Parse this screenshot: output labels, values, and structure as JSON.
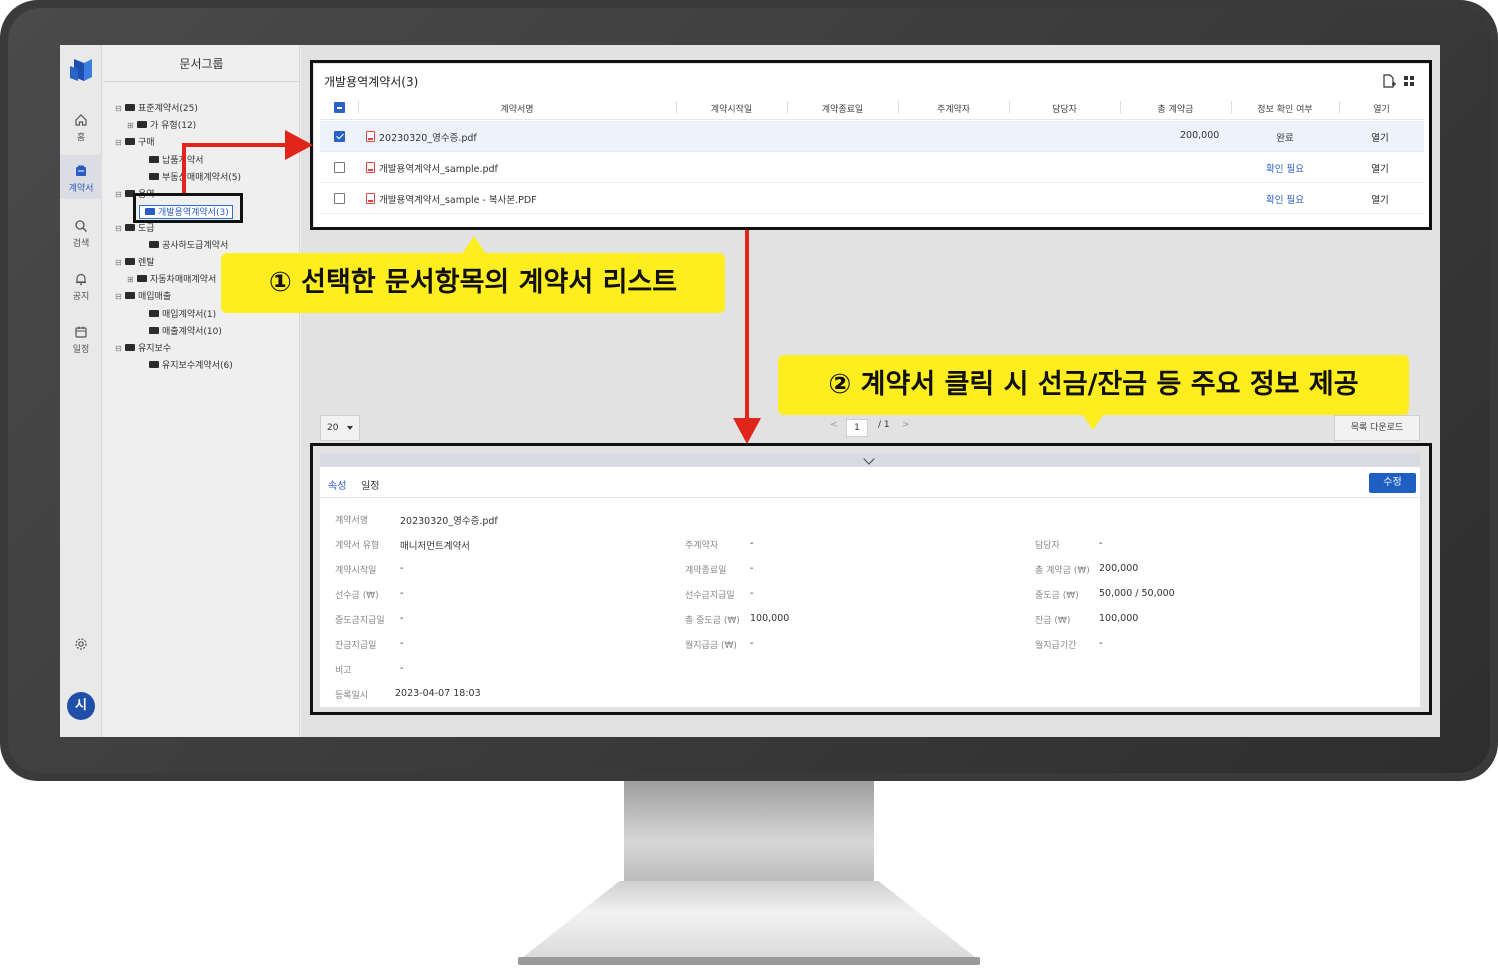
{
  "rail": {
    "items": [
      {
        "label": "홈",
        "icon": "home-icon"
      },
      {
        "label": "계약서",
        "icon": "contract-icon"
      },
      {
        "label": "검색",
        "icon": "search-icon"
      },
      {
        "label": "공지",
        "icon": "bell-icon"
      },
      {
        "label": "일정",
        "icon": "calendar-icon"
      }
    ],
    "avatar": "시",
    "accent": "#2a5cc2"
  },
  "tree": {
    "title": "문서그룹",
    "nodes": [
      {
        "label": "표준계약서(25)",
        "toggle": "⊟"
      },
      {
        "label": "가 유형(12)",
        "toggle": "⊞"
      },
      {
        "label": "구매",
        "toggle": "⊟"
      },
      {
        "label": "납품계약서",
        "toggle": ""
      },
      {
        "label": "부동산매매계약서(5)",
        "toggle": ""
      },
      {
        "label": "용역",
        "toggle": "⊟"
      },
      {
        "label": "개발용역계약서(3)",
        "toggle": ""
      },
      {
        "label": "도급",
        "toggle": "⊟"
      },
      {
        "label": "공사하도급계약서",
        "toggle": ""
      },
      {
        "label": "렌탈",
        "toggle": "⊟"
      },
      {
        "label": "자동차매매계약서",
        "toggle": "⊞"
      },
      {
        "label": "매입매출",
        "toggle": "⊟"
      },
      {
        "label": "매입계약서(1)",
        "toggle": ""
      },
      {
        "label": "매출계약서(10)",
        "toggle": ""
      },
      {
        "label": "유지보수",
        "toggle": "⊟"
      },
      {
        "label": "유지보수계약서(6)",
        "toggle": ""
      }
    ]
  },
  "list": {
    "title": "개발용역계약서(3)",
    "columns": [
      "계약서명",
      "계약시작일",
      "계약종료일",
      "주계약자",
      "담당자",
      "총 계약금",
      "정보 확인 여부",
      "열기"
    ],
    "rows": [
      {
        "name": "20230320_영수증.pdf",
        "amount": "200,000",
        "status": "완료",
        "open": "열기",
        "selected": true
      },
      {
        "name": "개발용역계약서_sample.pdf",
        "amount": "",
        "status": "확인 필요",
        "open": "열기",
        "selected": false
      },
      {
        "name": "개발용역계약서_sample - 복사본.PDF",
        "amount": "",
        "status": "확인 필요",
        "open": "열기",
        "selected": false
      }
    ]
  },
  "pager": {
    "page_size": "20",
    "current": "1",
    "total": "/ 1",
    "prev": "<",
    "next": ">",
    "download": "목록 다운로드"
  },
  "detail": {
    "tabs": [
      "속성",
      "일정"
    ],
    "edit": "수정",
    "fields": {
      "name_label": "계약서명",
      "name": "20230320_영수증.pdf",
      "type_label": "계약서 유형",
      "type": "매니저먼트계약서",
      "main_label": "주계약자",
      "main": "-",
      "mgr_label": "담당자",
      "mgr": "-",
      "start_label": "계약시작일",
      "start": "-",
      "end_label": "계약종료일",
      "end": "-",
      "total_label": "총 계약금 (₩)",
      "total": "200,000",
      "adv_label": "선수금 (₩)",
      "adv": "-",
      "advdate_label": "선수금지급일",
      "advdate": "-",
      "mid_label": "중도금 (₩)",
      "mid": "50,000 / 50,000",
      "middate_label": "중도금지급일",
      "middate": "-",
      "midtotal_label": "총 중도금 (₩)",
      "midtotal": "100,000",
      "bal_label": "잔금 (₩)",
      "bal": "100,000",
      "baldate_label": "잔금지급일",
      "baldate": "-",
      "monthly_label": "월지급금 (₩)",
      "monthly": "-",
      "period_label": "월지급기간",
      "period": "-",
      "note_label": "비고",
      "note": "-",
      "reg_label": "등록일시",
      "reg": "2023-04-07 18:03"
    }
  },
  "annotations": {
    "callout1": "① 선택한 문서항목의 계약서 리스트",
    "callout2": "② 계약서 클릭 시 선금/잔금 등 주요 정보 제공",
    "callout_color": "#ffee1f",
    "arrow_color": "#e0261b"
  }
}
